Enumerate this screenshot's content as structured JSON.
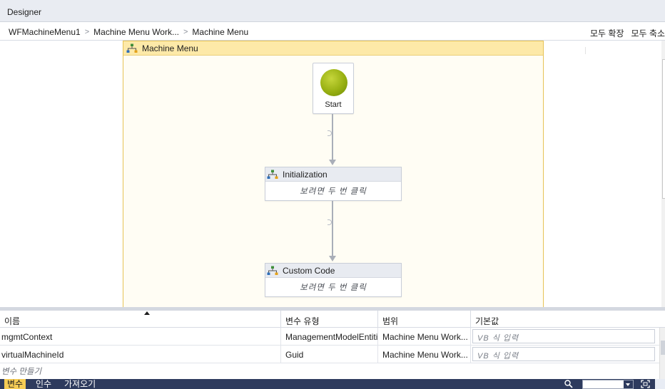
{
  "window": {
    "title": "Designer"
  },
  "breadcrumb": {
    "items": [
      "WFMachineMenu1",
      "Machine Menu Work...",
      "Machine Menu"
    ],
    "separator": ">",
    "expand_all": "모두 확장",
    "collapse_all": "모두 축소"
  },
  "flowchart": {
    "title": "Machine Menu",
    "start_label": "Start",
    "activities": [
      {
        "title": "Initialization",
        "body": "보려면 두 번 클릭"
      },
      {
        "title": "Custom Code",
        "body": "보려면 두 번 클릭"
      }
    ]
  },
  "variables": {
    "columns": [
      "이름",
      "변수 유형",
      "범위",
      "기본값"
    ],
    "rows": [
      {
        "name": "mgmtContext",
        "type": "ManagementModelEntiti",
        "scope": "Machine Menu Work...",
        "default_placeholder": "VB 식 입력"
      },
      {
        "name": "virtualMachineId",
        "type": "Guid",
        "scope": "Machine Menu Work...",
        "default_placeholder": "VB 식 입력"
      }
    ],
    "create_label": "변수 만들기"
  },
  "bottom_tabs": {
    "variables": "변수",
    "arguments": "인수",
    "imports": "가져오기"
  },
  "icons": {
    "flowchart": "flowchart-icon",
    "zoom": "magnifier-icon",
    "fit": "fit-to-screen-icon",
    "overview": "overview-icon"
  },
  "colors": {
    "accent": "#f5cc55",
    "bottom_bar": "#2e3b5e",
    "flowchart_header": "#fde9a8",
    "start_node": "#98b012"
  }
}
